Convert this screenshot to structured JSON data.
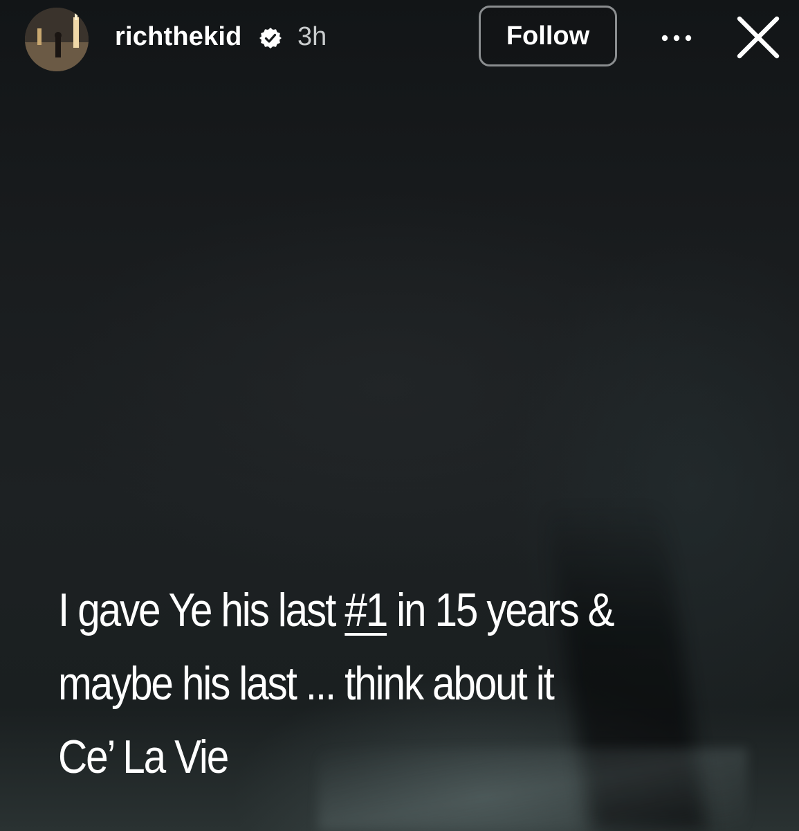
{
  "header": {
    "username": "richthekid",
    "time": "3h",
    "follow_label": "Follow",
    "verified_icon": "verified-badge-icon",
    "more_icon": "more-options-icon",
    "close_icon": "close-icon"
  },
  "caption": {
    "line1_part1": "I gave Ye his last ",
    "line1_hash": "#1",
    "line1_part2": " in 15 years &",
    "line2": "maybe his last ... think about it",
    "line3": "Ce’ La Vie"
  },
  "colors": {
    "text": "#ffffff",
    "time": "#c9cccd",
    "button_border": "#8a8d8f"
  }
}
